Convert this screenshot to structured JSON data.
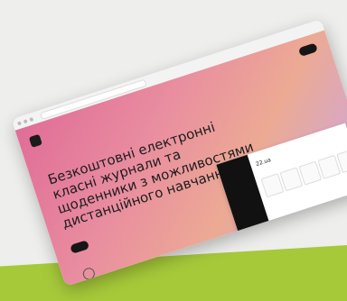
{
  "hero": {
    "headline": "Безкоштовні електронні класні журнали та щоденники з можливостями дистанційного навчання"
  },
  "dashboard": {
    "title": "22.ua"
  }
}
